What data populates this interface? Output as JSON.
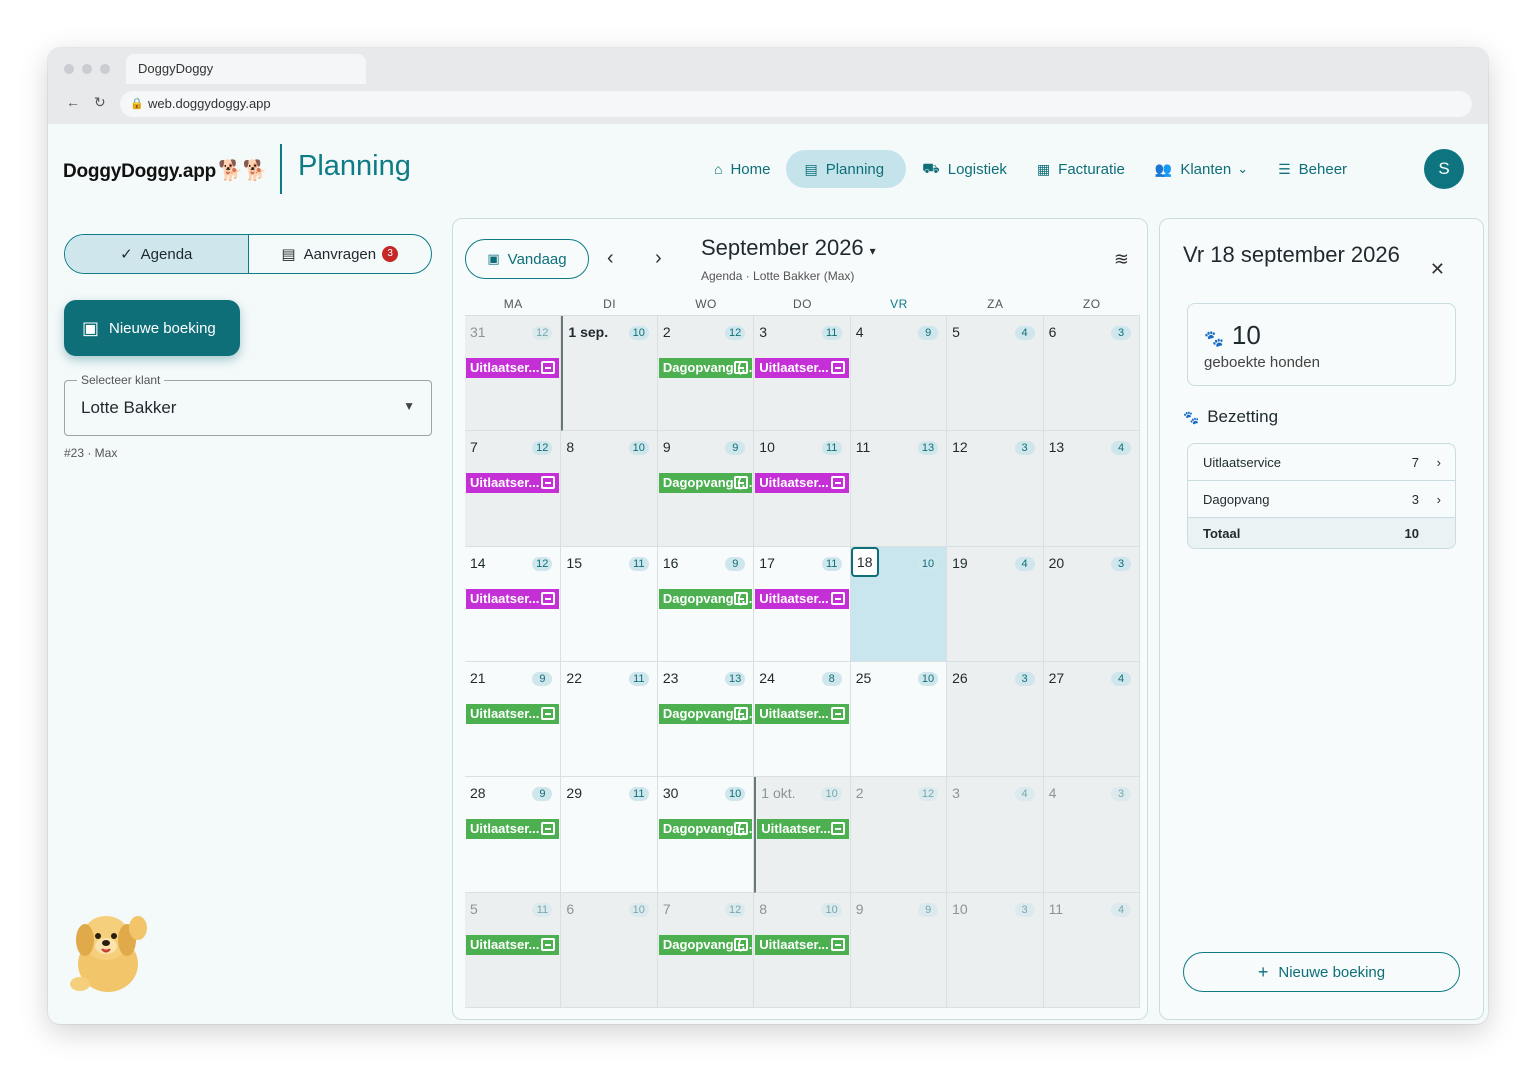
{
  "browser": {
    "tab_title": "DoggyDoggy",
    "url": "web.doggydoggy.app",
    "back_icon": "←",
    "reload_icon": "↻",
    "lock_icon": "🔒"
  },
  "header": {
    "logo_text": "DoggyDoggy.app",
    "logo_icon": "🐕🐕",
    "page_title": "Planning",
    "nav": [
      {
        "label": "Home",
        "icon": "⌂"
      },
      {
        "label": "Planning",
        "icon": "▤"
      },
      {
        "label": "Logistiek",
        "icon": "⛟"
      },
      {
        "label": "Facturatie",
        "icon": "▦"
      },
      {
        "label": "Klanten",
        "icon": "👥"
      },
      {
        "label": "Beheer",
        "icon": "☰"
      }
    ],
    "klanten_chevron": "⌄",
    "avatar_initial": "S"
  },
  "left": {
    "toggle_agenda": "Agenda",
    "toggle_agenda_icon": "✓",
    "toggle_aanvragen": "Aanvragen",
    "toggle_aanvragen_icon": "▤",
    "aanvragen_count": "3",
    "new_booking": "Nieuwe boeking",
    "new_booking_icon": "▣",
    "select_label": "Selecteer klant",
    "select_value": "Lotte Bakker",
    "select_caret": "▼",
    "helper": "#23 · Max"
  },
  "calendar": {
    "today_label": "Vandaag",
    "today_icon": "▣",
    "prev_icon": "‹",
    "next_icon": "›",
    "month_label": "September 2026",
    "month_caret": "▾",
    "subtitle": "Agenda · Lotte Bakker (Max)",
    "filter_icon": "≋",
    "weekdays": [
      "MA",
      "DI",
      "WO",
      "DO",
      "VR",
      "ZA",
      "ZO"
    ],
    "weeks": [
      [
        {
          "day": "31",
          "count": "12",
          "out": true,
          "event": {
            "label": "Uitlaatser...",
            "color": "purple"
          }
        },
        {
          "day": "1 sep.",
          "count": "10",
          "bold": true,
          "boundary": true
        },
        {
          "day": "2",
          "count": "12",
          "event": {
            "label": "Dagopvang (...",
            "color": "green"
          }
        },
        {
          "day": "3",
          "count": "11",
          "event": {
            "label": "Uitlaatser...",
            "color": "purple"
          }
        },
        {
          "day": "4",
          "count": "9"
        },
        {
          "day": "5",
          "count": "4"
        },
        {
          "day": "6",
          "count": "3"
        }
      ],
      [
        {
          "day": "7",
          "count": "12",
          "event": {
            "label": "Uitlaatser...",
            "color": "purple"
          }
        },
        {
          "day": "8",
          "count": "10"
        },
        {
          "day": "9",
          "count": "9",
          "event": {
            "label": "Dagopvang (...",
            "color": "green"
          }
        },
        {
          "day": "10",
          "count": "11",
          "event": {
            "label": "Uitlaatser...",
            "color": "purple"
          }
        },
        {
          "day": "11",
          "count": "13"
        },
        {
          "day": "12",
          "count": "3"
        },
        {
          "day": "13",
          "count": "4"
        }
      ],
      [
        {
          "day": "14",
          "count": "12",
          "event": {
            "label": "Uitlaatser...",
            "color": "purple"
          }
        },
        {
          "day": "15",
          "count": "11"
        },
        {
          "day": "16",
          "count": "9",
          "event": {
            "label": "Dagopvang (...",
            "color": "green"
          }
        },
        {
          "day": "17",
          "count": "11",
          "event": {
            "label": "Uitlaatser...",
            "color": "purple"
          }
        },
        {
          "day": "18",
          "count": "10",
          "selected": true
        },
        {
          "day": "19",
          "count": "4"
        },
        {
          "day": "20",
          "count": "3"
        }
      ],
      [
        {
          "day": "21",
          "count": "9",
          "event": {
            "label": "Uitlaatser...",
            "color": "green"
          }
        },
        {
          "day": "22",
          "count": "11"
        },
        {
          "day": "23",
          "count": "13",
          "event": {
            "label": "Dagopvang (...",
            "color": "green"
          }
        },
        {
          "day": "24",
          "count": "8",
          "event": {
            "label": "Uitlaatser...",
            "color": "green"
          }
        },
        {
          "day": "25",
          "count": "10"
        },
        {
          "day": "26",
          "count": "3"
        },
        {
          "day": "27",
          "count": "4"
        }
      ],
      [
        {
          "day": "28",
          "count": "9",
          "event": {
            "label": "Uitlaatser...",
            "color": "green"
          }
        },
        {
          "day": "29",
          "count": "11"
        },
        {
          "day": "30",
          "count": "10",
          "event": {
            "label": "Dagopvang (...",
            "color": "green"
          }
        },
        {
          "day": "1 okt.",
          "count": "10",
          "out": true,
          "boundary": true,
          "event": {
            "label": "Uitlaatser...",
            "color": "green"
          }
        },
        {
          "day": "2",
          "count": "12",
          "out": true
        },
        {
          "day": "3",
          "count": "4",
          "out": true
        },
        {
          "day": "4",
          "count": "3",
          "out": true
        }
      ],
      [
        {
          "day": "5",
          "count": "11",
          "out": true,
          "event": {
            "label": "Uitlaatser...",
            "color": "green"
          }
        },
        {
          "day": "6",
          "count": "10",
          "out": true
        },
        {
          "day": "7",
          "count": "12",
          "out": true,
          "event": {
            "label": "Dagopvang (...",
            "color": "green"
          }
        },
        {
          "day": "8",
          "count": "10",
          "out": true,
          "event": {
            "label": "Uitlaatser...",
            "color": "green"
          }
        },
        {
          "day": "9",
          "count": "9",
          "out": true
        },
        {
          "day": "10",
          "count": "3",
          "out": true
        },
        {
          "day": "11",
          "count": "4",
          "out": true
        }
      ]
    ]
  },
  "detail": {
    "title": "Vr 18 september 2026",
    "close_icon": "✕",
    "stat_value": "10",
    "stat_icon": "🐾",
    "stat_label": "geboekte honden",
    "bezetting_label": "Bezetting",
    "bezetting_icon": "🐾",
    "rows": [
      {
        "name": "Uitlaatservice",
        "count": "7",
        "chevron": "›"
      },
      {
        "name": "Dagopvang",
        "count": "3",
        "chevron": "›"
      }
    ],
    "total_label": "Totaal",
    "total_value": "10",
    "new_booking": "Nieuwe boeking",
    "plus_icon": "+"
  },
  "colors": {
    "accent": "#0e7c86",
    "event_purple": "#c42fd6",
    "event_green": "#4caf50",
    "selected_day": "#c9e6ee",
    "badge_red": "#c62828"
  }
}
